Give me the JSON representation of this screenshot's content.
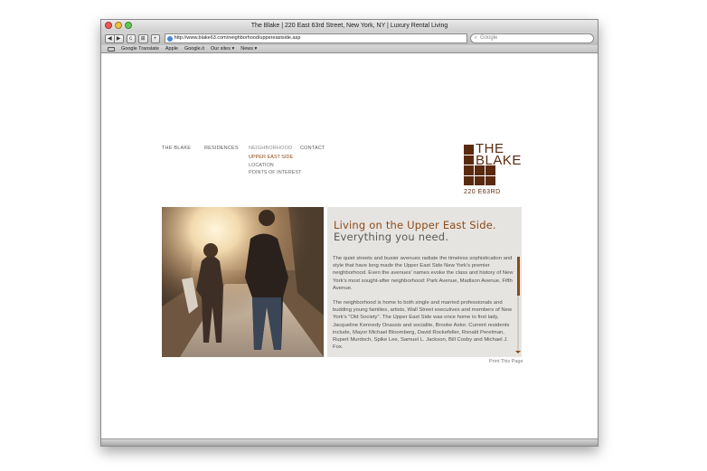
{
  "window": {
    "title": "The Blake | 220 East 63rd Street, New York, NY | Luxury Rental Living"
  },
  "toolbar": {
    "back_label": "◀",
    "forward_label": "▶",
    "reload_label": "c",
    "bookmark_label": "⊞",
    "add_label": "+",
    "url": "http://www.blake63.com/neighborhood/uppereastside.asp",
    "search_placeholder": "Google"
  },
  "bookmarks": [
    "Google Translate",
    "Apple",
    "Google.it",
    "Our sites ▾",
    "News ▾"
  ],
  "site": {
    "nav": {
      "the_blake": "THE BLAKE",
      "residences": "RESIDENCES",
      "neighborhood": "NEIGHBORHOOD",
      "contact": "CONTACT"
    },
    "subnav": {
      "upper_east_side": "UPPER EAST SIDE",
      "location": "LOCATION",
      "points_of_interest": "POINTS OF INTEREST"
    },
    "logo": {
      "word1": "THE",
      "word2": "BLAKE",
      "address": "220 E63RD"
    },
    "panel": {
      "heading1": "Living on the Upper East Side.",
      "heading2": "Everything you need.",
      "paragraph1": "The quiet streets and busier avenues radiate the timeless sophistication and style that have long made the Upper East Side New York's premier neighborhood. Even the avenues' names evoke the class and history of New York's most sought-after neighborhood: Park Avenue, Madison Avenue, Fifth Avenue.",
      "paragraph2": "The neighborhood is home to both single and married professionals and budding young families, artists, Wall Street executives and members of New York's \"Old Society\". The Upper East Side was once home to first lady, Jacqueline Kennedy Onassis and socialite, Brooke Astor. Current residents include, Mayor Michael Bloomberg, David Rockefeller, Ronald Perelman, Rupert Murdoch, Spike Lee, Samuel L. Jackson, Bill Cosby and Michael J. Fox."
    },
    "print_label": "Print This Page"
  },
  "colors": {
    "brand_brown": "#5a2a10",
    "accent_brown": "#8b4b17",
    "panel_bg": "#e6e4e1"
  }
}
